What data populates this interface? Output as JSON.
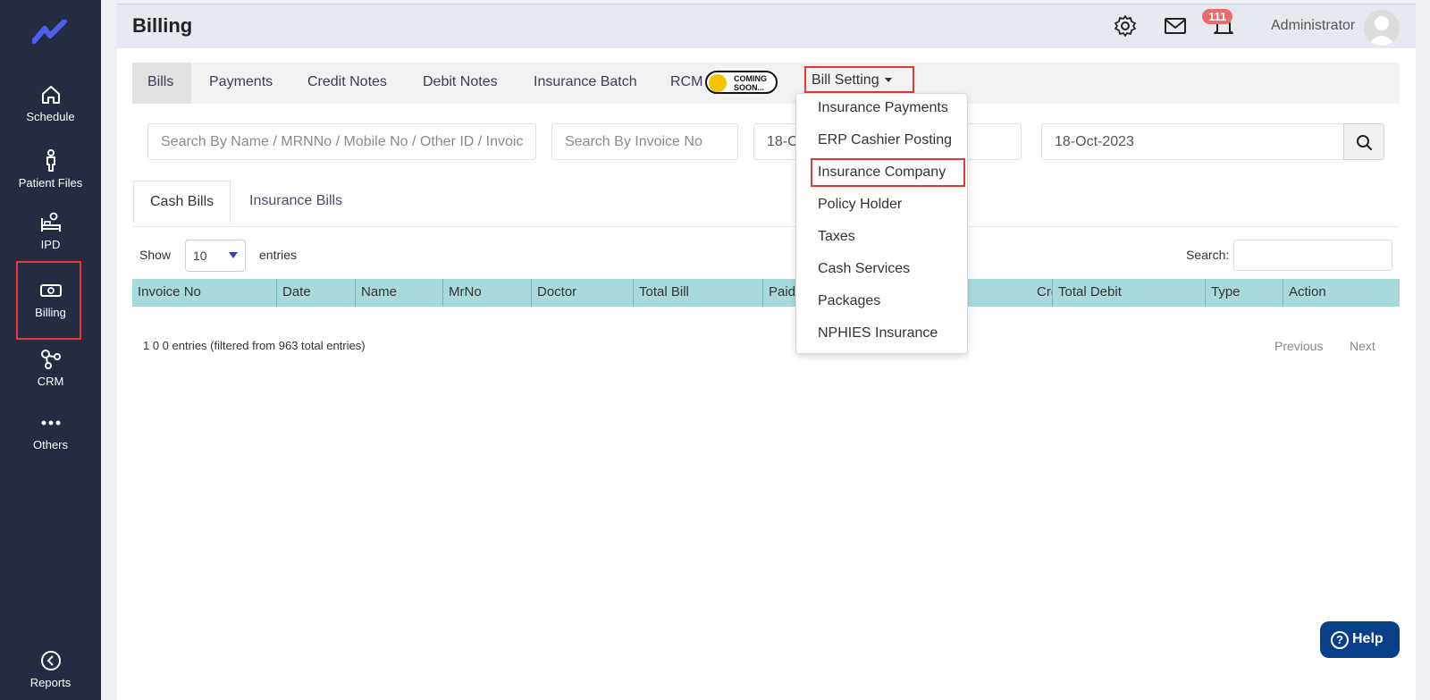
{
  "sidebar": {
    "items": [
      {
        "label": "Schedule"
      },
      {
        "label": "Patient Files"
      },
      {
        "label": "IPD"
      },
      {
        "label": "Billing"
      },
      {
        "label": "CRM"
      },
      {
        "label": "Others"
      },
      {
        "label": "Reports"
      }
    ],
    "active": "Billing"
  },
  "header": {
    "title": "Billing",
    "notification_count": "111",
    "user_name": "Administrator"
  },
  "tabs": {
    "bills": "Bills",
    "payments": "Payments",
    "credit_notes": "Credit Notes",
    "debit_notes": "Debit Notes",
    "insurance_batch": "Insurance Batch",
    "rcm": "RCM",
    "coming_soon_line1": "COMING",
    "coming_soon_line2": "SOON...",
    "bill_setting": "Bill Setting"
  },
  "dropdown": {
    "items": [
      "Insurance Payments",
      "ERP Cashier Posting",
      "Insurance Company",
      "Policy Holder",
      "Taxes",
      "Cash Services",
      "Packages",
      "NPHIES Insurance"
    ],
    "highlighted": "Insurance Company"
  },
  "filters": {
    "search_placeholder": "Search By Name / MRNNo / Mobile No / Other ID / Invoic",
    "invoice_placeholder": "Search By Invoice No",
    "from_date": "18-O",
    "to_date": "18-Oct-2023"
  },
  "subtabs": {
    "cash_bills": "Cash Bills",
    "insurance_bills": "Insurance Bills"
  },
  "table": {
    "show_label": "Show",
    "entries_value": "10",
    "entries_label": "entries",
    "search_label": "Search:",
    "columns": [
      "Invoice No",
      "Date",
      "Name",
      "MrNo",
      "Doctor",
      "Total Bill",
      "Paid",
      "Credit",
      "Total Debit",
      "Type",
      "Action"
    ],
    "info": "1 0 0 entries (filtered from 963 total entries)",
    "previous": "Previous",
    "next": "Next"
  },
  "help": {
    "label": "Help"
  },
  "colors": {
    "sidebar_bg": "#252b40",
    "table_header": "#a8dadc",
    "highlight_red": "#e53935",
    "help_bg": "#083f8a",
    "badge": "#ee6a6a"
  }
}
